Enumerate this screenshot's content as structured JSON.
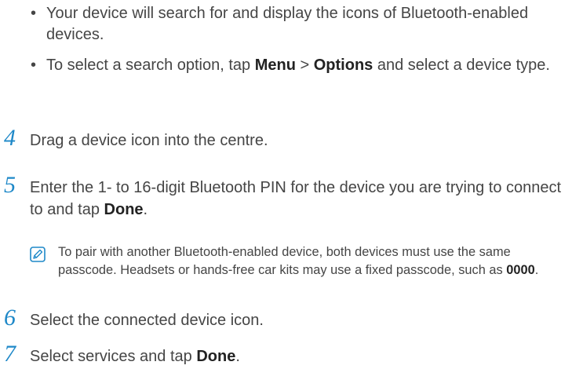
{
  "bullets": [
    {
      "text": "Your device will search for and display the icons of Bluetooth-enabled devices."
    },
    {
      "t1": "To select a search option, tap ",
      "b1": "Menu",
      "t2": " > ",
      "b2": "Options",
      "t3": " and select a device type."
    }
  ],
  "steps": {
    "s4": {
      "number": "4",
      "text": "Drag a device icon into the centre."
    },
    "s5": {
      "number": "5",
      "t1": "Enter the 1- to 16-digit Bluetooth PIN for the device you are trying to connect to and tap ",
      "b1": "Done",
      "t2": "."
    },
    "s6": {
      "number": "6",
      "text": "Select the connected device icon."
    },
    "s7": {
      "number": "7",
      "t1": "Select services and tap ",
      "b1": "Done",
      "t2": "."
    }
  },
  "note": {
    "icon": "note-pencil-icon",
    "t1": "To pair with another Bluetooth-enabled device, both devices must use the same passcode. Headsets or hands-free car kits may use a fixed passcode, such as ",
    "b1": "0000",
    "t2": "."
  },
  "colors": {
    "step_number": "#1e88c8",
    "body_text": "#454545"
  }
}
